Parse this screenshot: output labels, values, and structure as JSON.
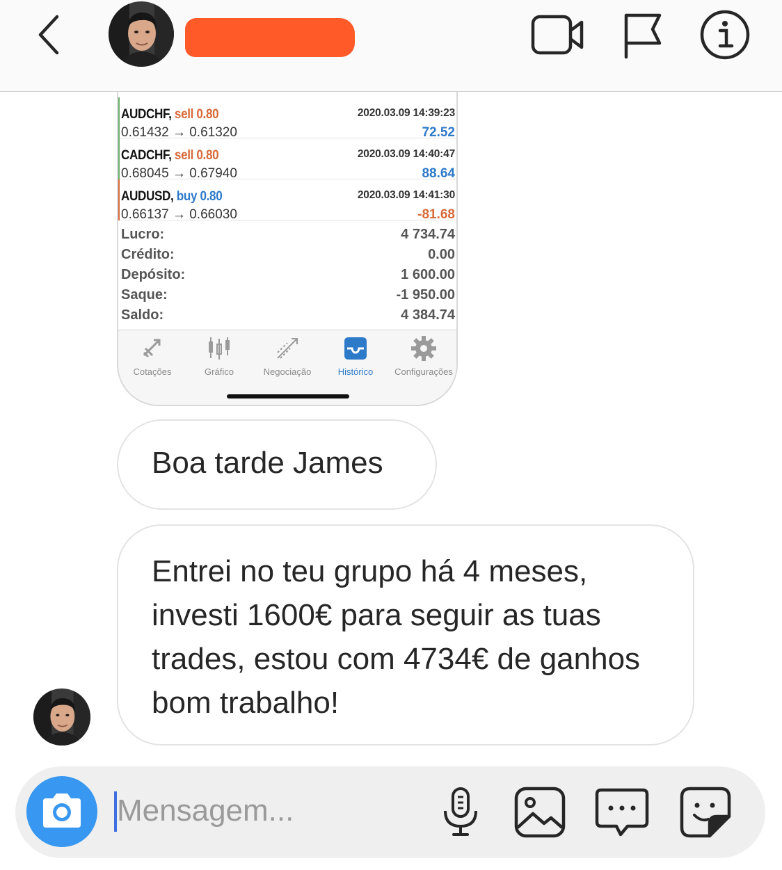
{
  "header": {
    "back_icon": "chevron-left-icon",
    "avatar": "contact-avatar",
    "name_redacted": true,
    "actions": [
      "video-call-icon",
      "flag-icon",
      "info-icon"
    ]
  },
  "shared_screenshot": {
    "trades": [
      {
        "symbol": "AUDCHF,",
        "side": "sell 0.80",
        "prices": "0.61432 → 0.61320",
        "time": "2020.03.09 14:39:23",
        "profit": "72.52",
        "edge_color": "#6bb06b"
      },
      {
        "symbol": "CADCHF,",
        "side": "sell 0.80",
        "prices": "0.68045 → 0.67940",
        "time": "2020.03.09 14:40:47",
        "profit": "88.64",
        "edge_color": "#6bb06b"
      },
      {
        "symbol": "AUDUSD,",
        "side": "buy 0.80",
        "prices": "0.66137 → 0.66030",
        "time": "2020.03.09 14:41:30",
        "profit": "-81.68",
        "edge_color": "#d86a3a"
      }
    ],
    "summary": [
      {
        "label": "Lucro:",
        "value": "4 734.74"
      },
      {
        "label": "Crédito:",
        "value": "0.00"
      },
      {
        "label": "Depósito:",
        "value": "1 600.00"
      },
      {
        "label": "Saque:",
        "value": "-1 950.00"
      },
      {
        "label": "Saldo:",
        "value": "4 384.74"
      }
    ],
    "tabs": [
      {
        "label": "Cotações",
        "icon": "quotes-icon"
      },
      {
        "label": "Gráfico",
        "icon": "candlestick-chart-icon"
      },
      {
        "label": "Negociação",
        "icon": "trade-icon"
      },
      {
        "label": "Histórico",
        "icon": "history-inbox-icon",
        "active": true
      },
      {
        "label": "Configurações",
        "icon": "gear-icon"
      }
    ]
  },
  "messages": [
    {
      "text": "Boa tarde James"
    },
    {
      "text": "Entrei no teu grupo há 4 meses, investi 1600€ para seguir as tuas trades, estou com 4734€ de ganhos bom trabalho!"
    }
  ],
  "composer": {
    "placeholder": "Mensagem...",
    "value": "",
    "icons": [
      "camera-icon",
      "microphone-icon",
      "image-gallery-icon",
      "chat-bubble-icon",
      "sticker-icon"
    ]
  },
  "colors": {
    "accent_blue": "#3897f0",
    "profit_blue": "#2d7ac9",
    "loss_orange": "#d86a3a",
    "redaction": "#ff5a28"
  }
}
